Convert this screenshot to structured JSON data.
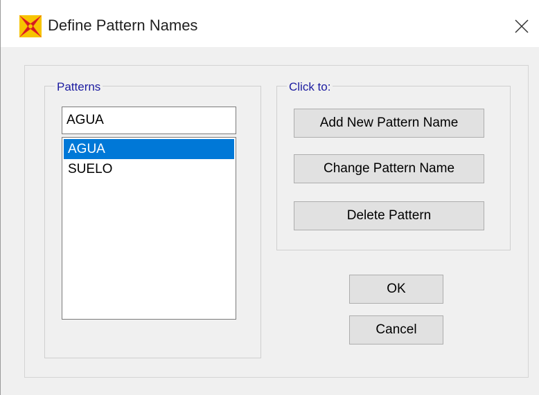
{
  "window": {
    "title": "Define Pattern Names",
    "icon": "sap-app-icon",
    "close_icon": "close-icon"
  },
  "patterns_group": {
    "label": "Patterns",
    "input_value": "AGUA",
    "items": [
      {
        "label": "AGUA",
        "selected": true
      },
      {
        "label": "SUELO",
        "selected": false
      }
    ]
  },
  "click_group": {
    "label": "Click to:",
    "add_label": "Add New Pattern Name",
    "change_label": "Change Pattern Name",
    "delete_label": "Delete Pattern"
  },
  "actions": {
    "ok_label": "OK",
    "cancel_label": "Cancel"
  },
  "colors": {
    "selection": "#0078d7",
    "group_label": "#1b1ba0",
    "app_icon_primary": "#e8232a",
    "app_icon_secondary": "#f7c400"
  }
}
